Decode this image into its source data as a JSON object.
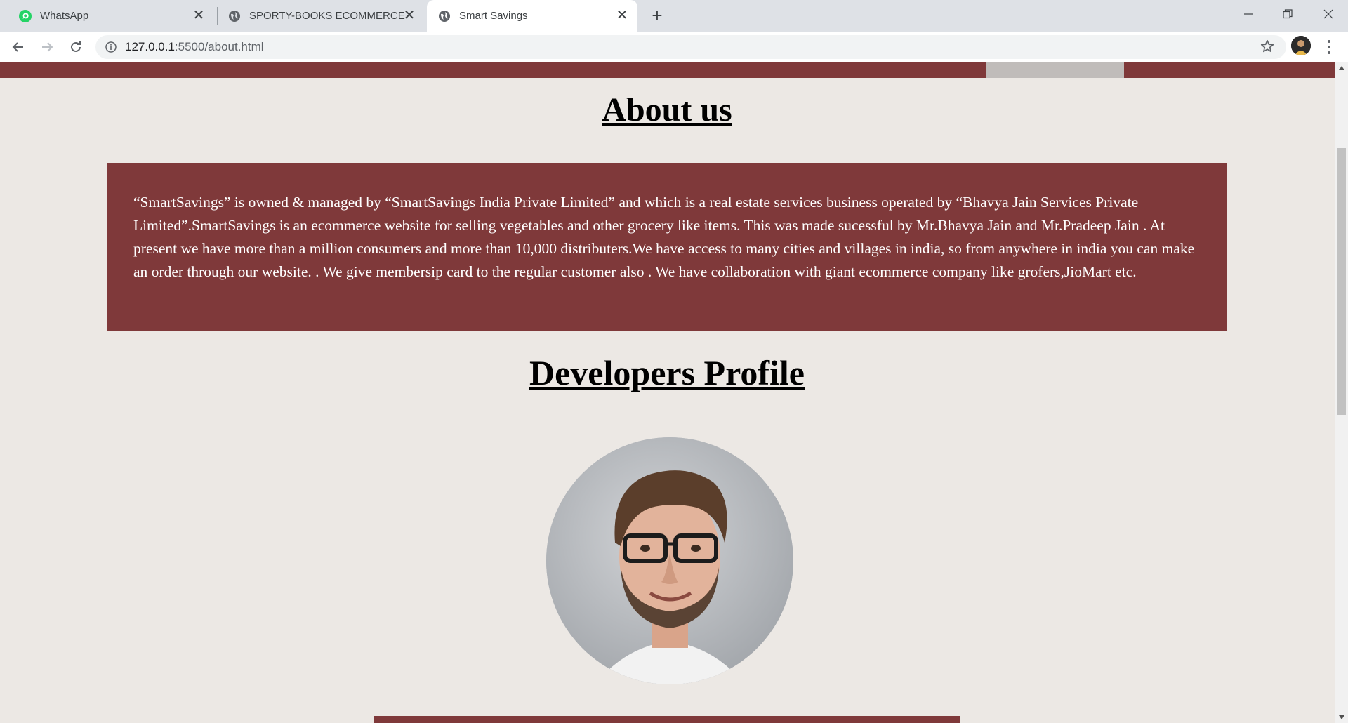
{
  "browser": {
    "tabs": [
      {
        "title": "WhatsApp",
        "icon": "whatsapp-icon",
        "active": false
      },
      {
        "title": "SPORTY-BOOKS ECOMMERCE",
        "icon": "globe-icon",
        "active": false
      },
      {
        "title": "Smart Savings",
        "icon": "globe-icon",
        "active": true
      }
    ],
    "close_glyph": "✕",
    "new_tab_glyph": "+",
    "url_host": "127.0.0.1",
    "url_path": ":5500/about.html"
  },
  "page": {
    "about_title": "About us",
    "about_text": "“SmartSavings” is owned & managed by “SmartSavings India Private Limited” and which is a real estate services business operated by “Bhavya Jain Services Private Limited”.SmartSavings is an ecommerce website for selling vegetables and other grocery like items. This was made sucessful by Mr.Bhavya Jain and Mr.Pradeep Jain . At present we have more than a million consumers and more than 10,000 distributers.We have access to many cities and villages in india, so from anywhere in india you can make an order through our website. . We give membersip card to the regular customer also . We have collaboration with giant ecommerce company like grofers,JioMart etc.",
    "developers_title": "Developers Profile"
  },
  "colors": {
    "accent": "#7f393a",
    "background": "#ece8e4",
    "tab_strip": "#dee1e6"
  }
}
